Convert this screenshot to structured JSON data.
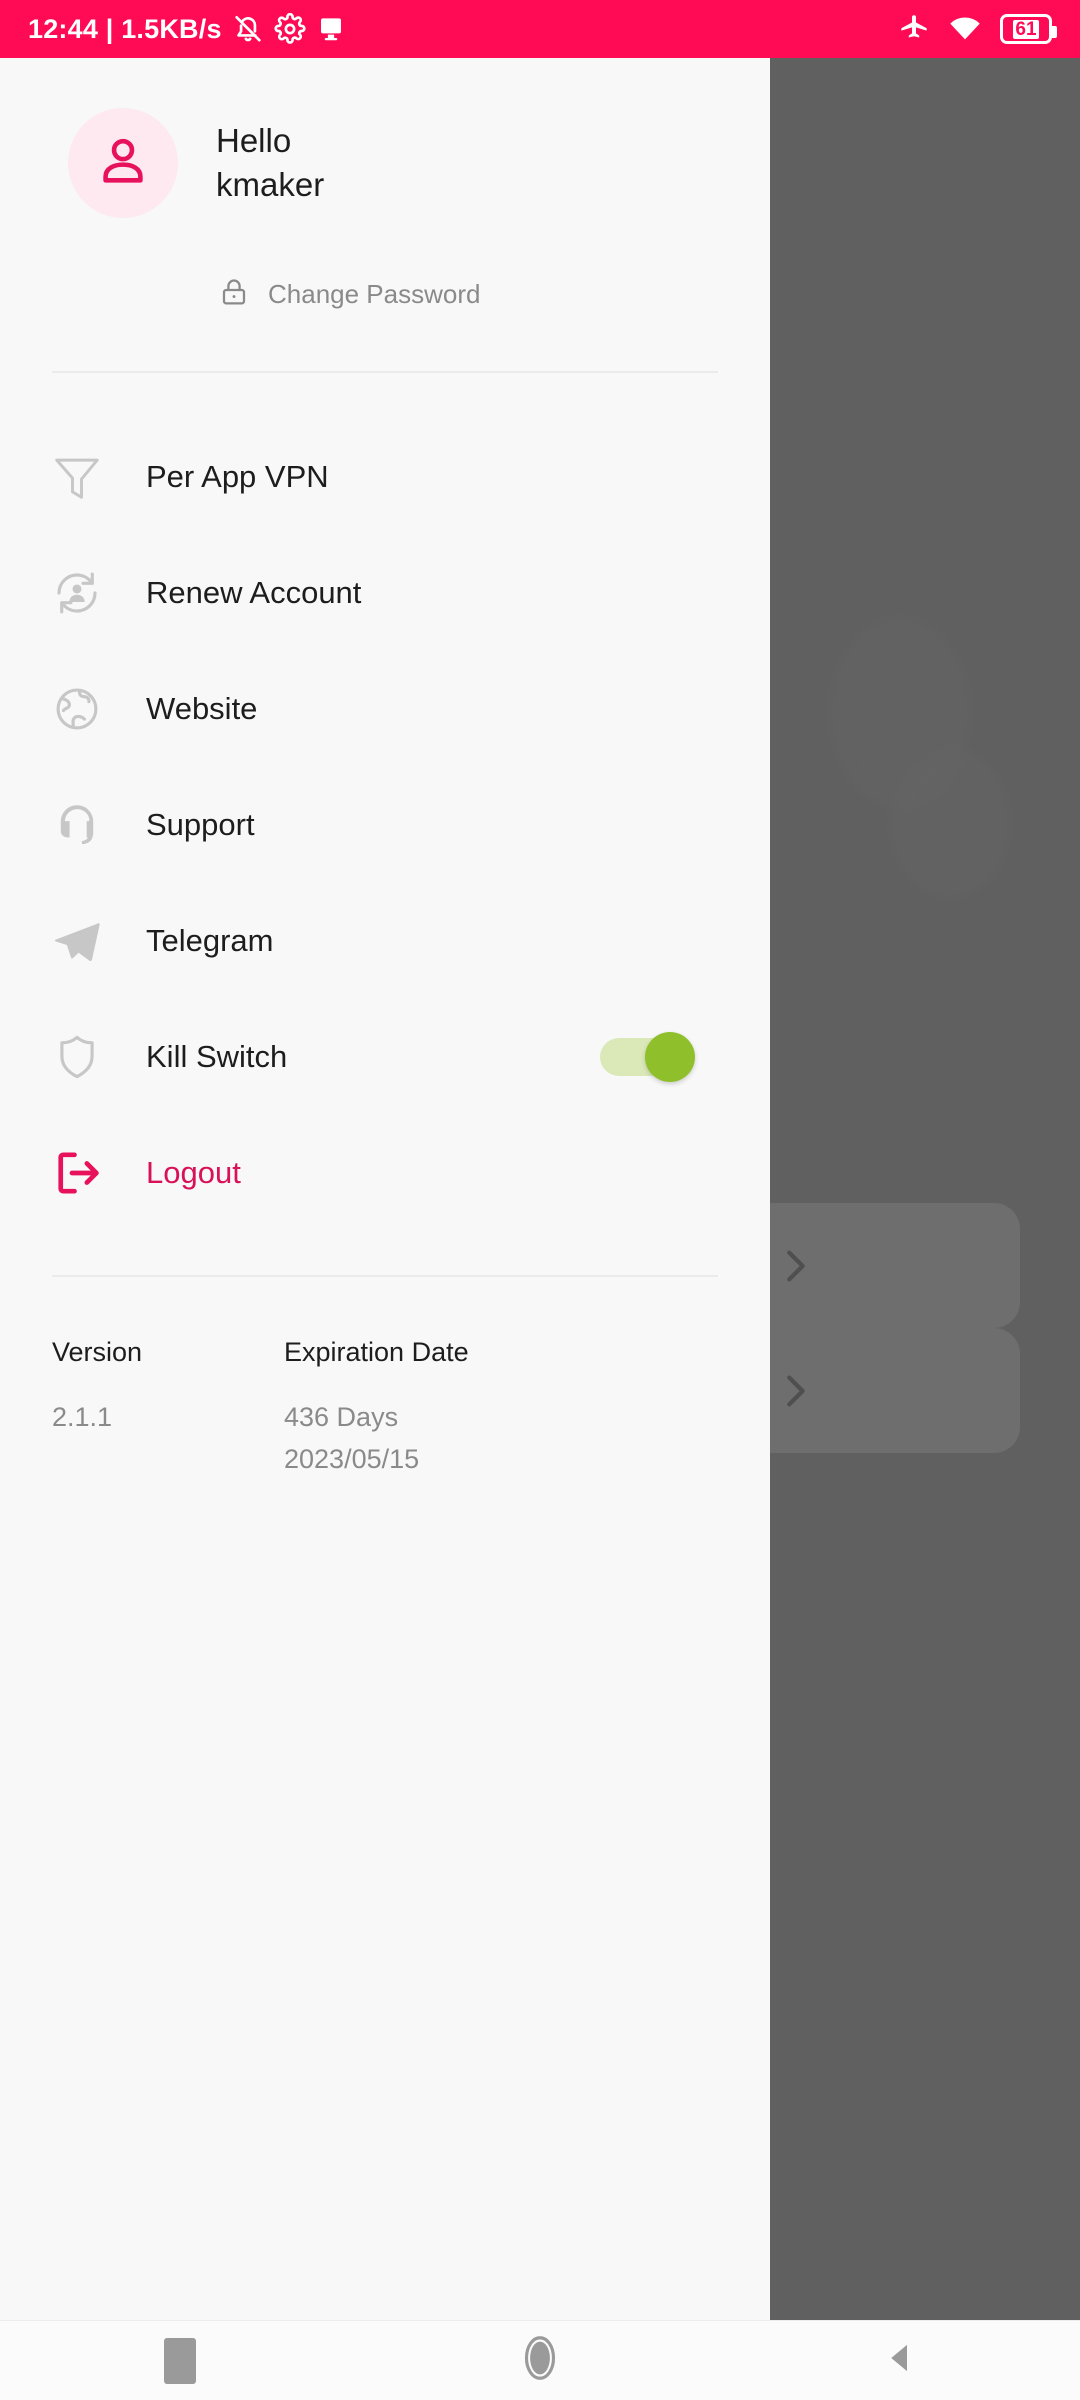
{
  "statusbar": {
    "clock": "12:44 | 1.5KB/s",
    "icons_left": [
      "mute-bell-icon",
      "gear-icon",
      "cast-screen-icon"
    ],
    "icons_right": [
      "airplane-mode-icon",
      "wifi-icon",
      "battery-icon"
    ],
    "battery_level": "61",
    "background_color": "#ff0a55",
    "text_color": "#ffffff"
  },
  "drawer": {
    "profile": {
      "avatar_icon": "person-icon",
      "greeting_line1": "Hello",
      "greeting_line2": "kmaker",
      "change_password": {
        "icon": "lock-icon",
        "label": "Change Password"
      }
    },
    "menu": [
      {
        "icon": "filter-funnel-icon",
        "label": "Per App VPN",
        "type": "link",
        "accent": false
      },
      {
        "icon": "account-sync-icon",
        "label": "Renew Account",
        "type": "link",
        "accent": false
      },
      {
        "icon": "globe-icon",
        "label": "Website",
        "type": "link",
        "accent": false
      },
      {
        "icon": "headset-support-icon",
        "label": "Support",
        "type": "link",
        "accent": false
      },
      {
        "icon": "telegram-plane-icon",
        "label": "Telegram",
        "type": "link",
        "accent": false
      },
      {
        "icon": "shield-icon",
        "label": "Kill Switch",
        "type": "toggle",
        "toggle_state": "on",
        "accent": false
      },
      {
        "icon": "logout-arrow-icon",
        "label": "Logout",
        "type": "link",
        "accent": true
      }
    ],
    "footer": {
      "version_title": "Version",
      "version_value": "2.1.1",
      "expiration_title": "Expiration Date",
      "expiration_days": "436 Days",
      "expiration_date": "2023/05/15"
    },
    "colors": {
      "accent": "#d81159",
      "avatar_bg": "#fde9ef",
      "toggle_on_thumb": "#8fc02c",
      "toggle_on_track": "#dbe9b9",
      "surface": "#f8f8f8",
      "muted_text": "#8a8a8a"
    }
  },
  "background": {
    "scrim_color": "#606060",
    "cards": [
      {
        "chevron_icon": "chevron-right-icon"
      },
      {
        "chevron_icon": "chevron-right-icon"
      }
    ]
  },
  "navbar": {
    "recents_icon": "square-recents-icon",
    "home_icon": "circle-home-icon",
    "back_icon": "triangle-back-icon"
  }
}
